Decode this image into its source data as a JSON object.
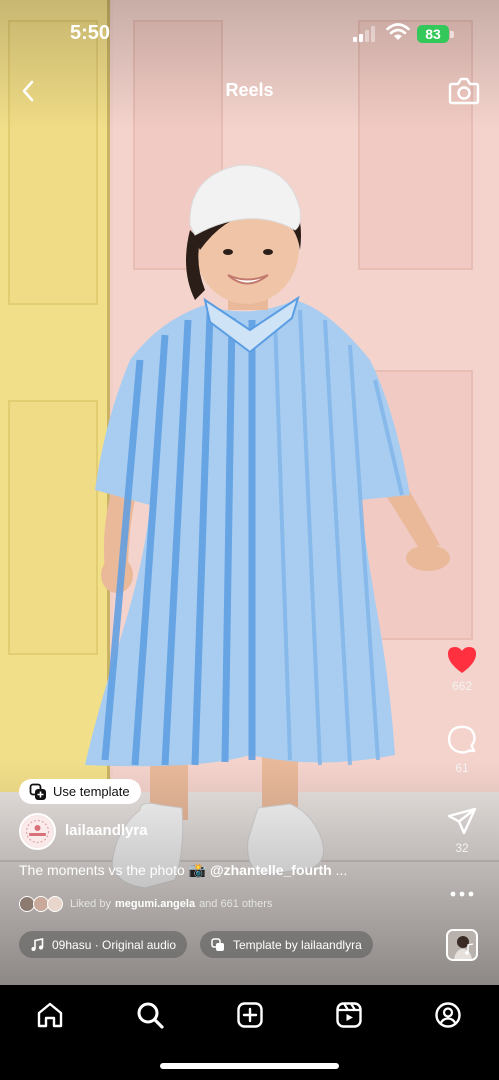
{
  "status_bar": {
    "time": "5:50",
    "battery": "83"
  },
  "header": {
    "title": "Reels",
    "back_icon": "chevron-left-icon",
    "camera_icon": "camera-icon"
  },
  "actions": {
    "likes": {
      "icon": "heart-icon",
      "count": "662",
      "color": "#ff3040",
      "liked": true
    },
    "comments": {
      "icon": "comment-icon",
      "count": "61"
    },
    "share": {
      "icon": "paper-plane-icon",
      "count": "32"
    },
    "more_icon": "more-horizontal-icon"
  },
  "post": {
    "use_template_label": "Use template",
    "username": "lailaandlyra",
    "caption_text": "The moments vs the photo 📸 ",
    "caption_mention": "@zhantelle_fourth",
    "caption_ellipsis": " ...",
    "liked_by_prefix": "Liked by",
    "liked_by_user": "megumi.angela",
    "liked_by_suffix": "and 661 others",
    "audio_label": "09hasu · Original audio",
    "template_label": "Template by lailaandlyra"
  },
  "tabbar": {
    "tabs": [
      {
        "name": "home",
        "icon": "home-icon"
      },
      {
        "name": "search",
        "icon": "search-icon",
        "active": true
      },
      {
        "name": "create",
        "icon": "plus-square-icon"
      },
      {
        "name": "reels",
        "icon": "reels-icon"
      },
      {
        "name": "profile",
        "icon": "profile-icon"
      }
    ]
  },
  "colors": {
    "like_red": "#ff3040",
    "battery_green": "#34c759"
  }
}
